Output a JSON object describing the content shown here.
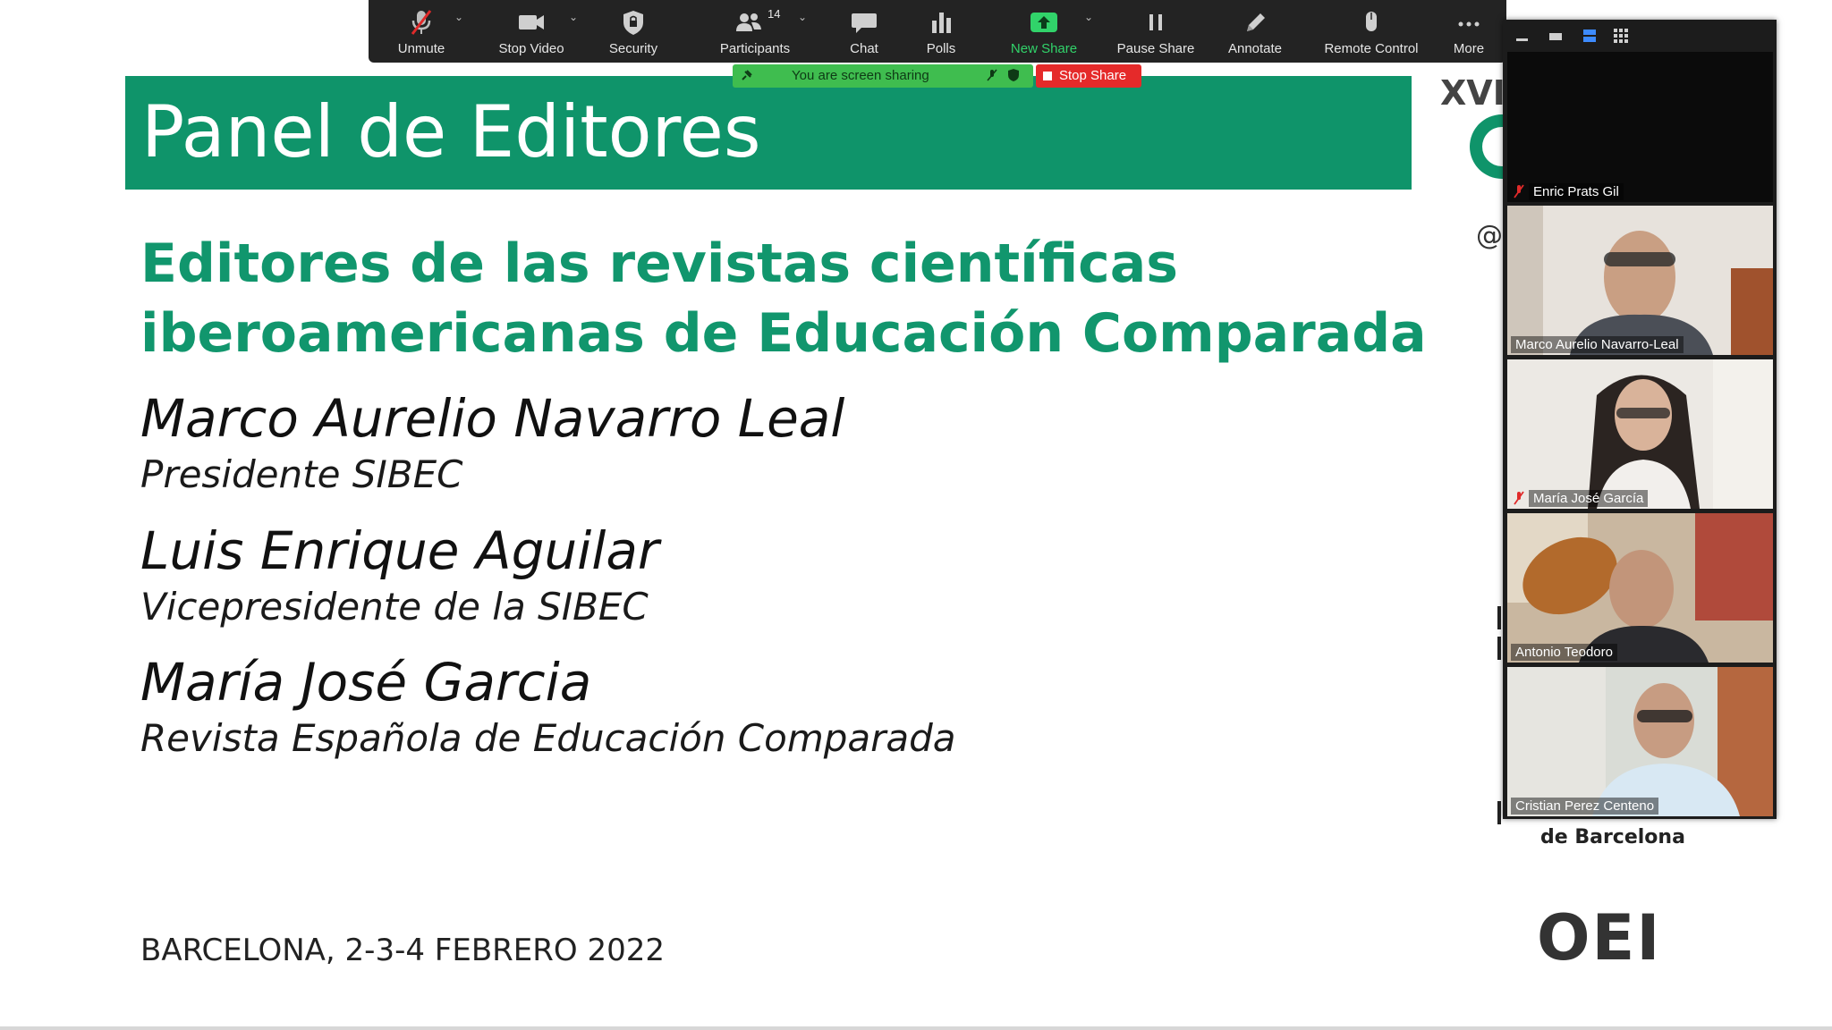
{
  "slide": {
    "title": "Panel de Editores",
    "subtitle_line1": "Editores de las revistas científicas",
    "subtitle_line2": "iberoamericanas de Educación Comparada",
    "people": [
      {
        "name": "Marco Aurelio Navarro Leal",
        "role": "Presidente SIBEC"
      },
      {
        "name": "Luis Enrique Aguilar",
        "role": "Vicepresidente de la SIBEC"
      },
      {
        "name": "María José Garcia",
        "role": "Revista Española de Educación Comparada"
      }
    ],
    "footer_date": "BARCELONA, 2-3-4 FEBRERO 2022",
    "edge_xvi": "XVI",
    "edge_at": "@",
    "university_text": "de Barcelona",
    "logo_text": "OEI"
  },
  "toolbar": {
    "participants_count": "14",
    "items": [
      {
        "label": "Unmute",
        "icon": "mic-muted-icon"
      },
      {
        "label": "Stop Video",
        "icon": "video-camera-icon"
      },
      {
        "label": "Security",
        "icon": "shield-icon"
      },
      {
        "label": "Participants",
        "icon": "participants-icon"
      },
      {
        "label": "Chat",
        "icon": "chat-bubble-icon"
      },
      {
        "label": "Polls",
        "icon": "bar-chart-icon"
      },
      {
        "label": "New Share",
        "icon": "share-arrow-icon"
      },
      {
        "label": "Pause Share",
        "icon": "pause-icon"
      },
      {
        "label": "Annotate",
        "icon": "pencil-icon"
      },
      {
        "label": "Remote Control",
        "icon": "mouse-icon"
      },
      {
        "label": "More",
        "icon": "ellipsis-icon"
      }
    ]
  },
  "share_banner": {
    "text": "You are screen sharing",
    "stop_label": "Stop Share"
  },
  "video_panel": {
    "participants": [
      {
        "name": "Enric Prats Gil",
        "muted": true,
        "video": false
      },
      {
        "name": "Marco Aurelio Navarro-Leal",
        "muted": false,
        "video": true
      },
      {
        "name": "María José García",
        "muted": true,
        "video": true
      },
      {
        "name": "Antonio Teodoro",
        "muted": false,
        "video": true
      },
      {
        "name": "Cristian Perez Centeno",
        "muted": false,
        "video": true
      }
    ]
  },
  "colors": {
    "slide_green": "#0f946a",
    "toolbar_bg": "#232323",
    "share_green": "#3fbd4f",
    "stop_red": "#e52a2a",
    "new_share_green": "#31d36a"
  }
}
